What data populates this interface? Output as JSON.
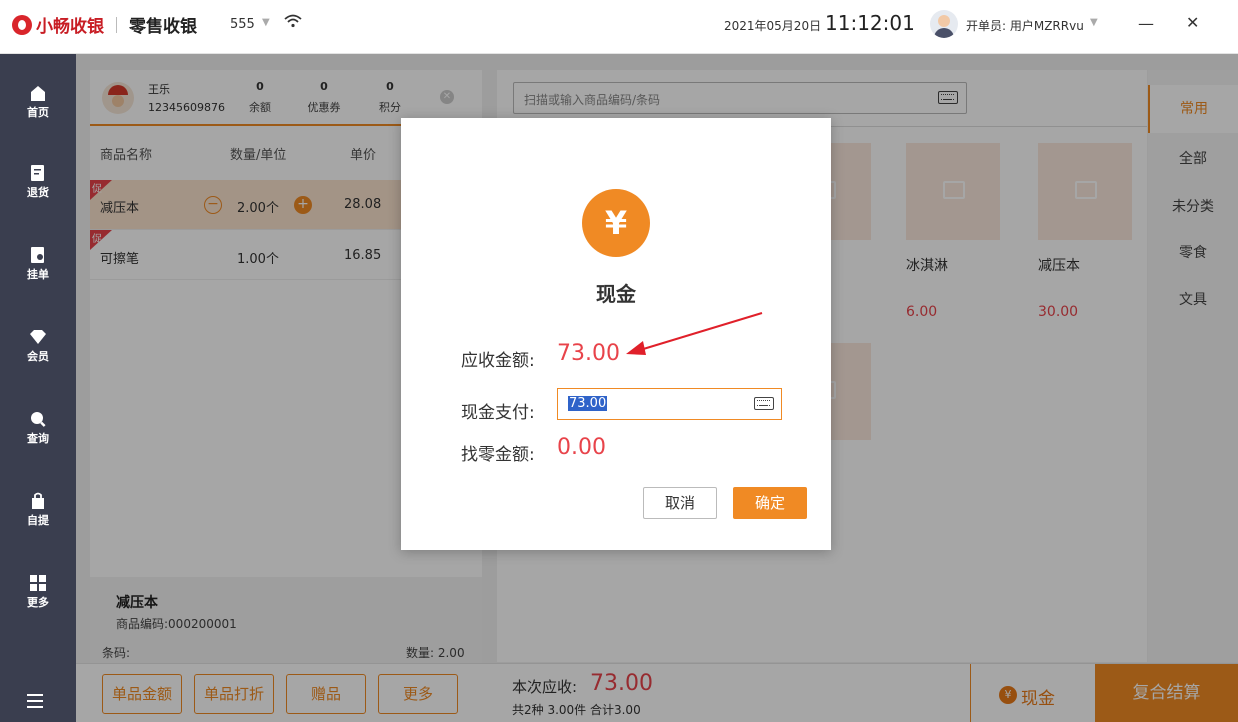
{
  "titlebar": {
    "brand": "小畅收银",
    "mode": "零售收银",
    "store_no": "555",
    "date": "2021年05月20日",
    "time": "11:12:01",
    "operator": "开单员: 用户MZRRvu",
    "minimize": "—",
    "close": "✕"
  },
  "nav": {
    "items": [
      {
        "label": "首页",
        "icon": "home-icon"
      },
      {
        "label": "退货",
        "icon": "return-icon"
      },
      {
        "label": "挂单",
        "icon": "hold-order-icon"
      },
      {
        "label": "会员",
        "icon": "member-diamond-icon"
      },
      {
        "label": "查询",
        "icon": "search-icon"
      },
      {
        "label": "自提",
        "icon": "pickup-bag-icon"
      },
      {
        "label": "更多",
        "icon": "grid-icon"
      }
    ]
  },
  "member": {
    "name": "王乐",
    "phone": "12345609876",
    "stats": [
      {
        "value": "0",
        "label": "余额"
      },
      {
        "value": "0",
        "label": "优惠券"
      },
      {
        "value": "0",
        "label": "积分"
      }
    ]
  },
  "cart": {
    "headers": {
      "name": "商品名称",
      "qty": "数量/单位",
      "price": "单价"
    },
    "promo_tag": "促",
    "items": [
      {
        "name": "减压本",
        "qty": "2.00个",
        "price": "28.08"
      },
      {
        "name": "可擦笔",
        "qty": "1.00个",
        "price": "16.85"
      }
    ]
  },
  "detail": {
    "name": "减压本",
    "code": "商品编码:000200001",
    "barcode": "条码:",
    "qty": "数量: 2.00"
  },
  "search": {
    "placeholder": "扫描或输入商品编码/条码"
  },
  "products": [
    {
      "name": "冰淇淋",
      "price": "6.00"
    },
    {
      "name": "减压本",
      "price": "30.00"
    }
  ],
  "categories": [
    "常用",
    "全部",
    "未分类",
    "零食",
    "文具"
  ],
  "bottom": {
    "buttons": [
      "单品金额",
      "单品打折",
      "赠品",
      "更多"
    ],
    "due_label": "本次应收:",
    "due_amount": "73.00",
    "summary": "共2种 3.00件 合计3.00",
    "cash_tab": "现金",
    "combo": "复合结算"
  },
  "dialog": {
    "coin": "¥",
    "title": "现金",
    "receivable_label": "应收金额:",
    "receivable_value": "73.00",
    "cash_label": "现金支付:",
    "cash_value": "73.00",
    "change_label": "找零金额:",
    "change_value": "0.00",
    "cancel": "取消",
    "confirm": "确定"
  },
  "colors": {
    "accent": "#f08a24",
    "price_red": "#e8434a",
    "nav_bg": "#3a3e4f"
  }
}
